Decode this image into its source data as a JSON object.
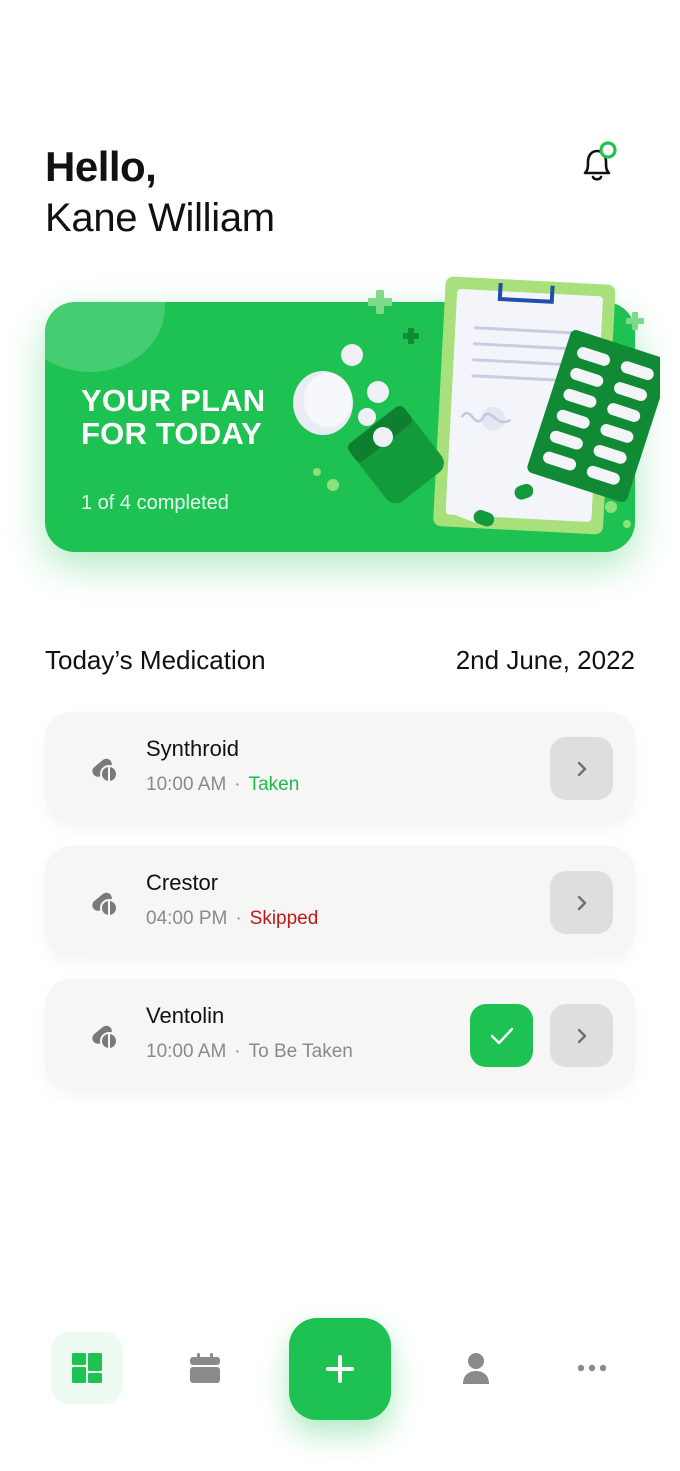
{
  "greeting": {
    "hello": "Hello,",
    "name": "Kane William"
  },
  "banner": {
    "title_line1": "YOUR PLAN",
    "title_line2": "FOR TODAY",
    "progress_text": "1 of 4 completed",
    "completed": 1,
    "total": 4
  },
  "medication": {
    "section_title": "Today’s Medication",
    "date": "2nd June, 2022",
    "items": [
      {
        "name": "Synthroid",
        "time": "10:00 AM",
        "status": "Taken"
      },
      {
        "name": "Crestor",
        "time": "04:00 PM",
        "status": "Skipped"
      },
      {
        "name": "Ventolin",
        "time": "10:00 AM",
        "status": "To Be Taken"
      }
    ]
  },
  "nav": {
    "items": [
      "dashboard-icon",
      "calendar-icon",
      "plus-icon",
      "profile-icon",
      "more-icon"
    ],
    "active": "dashboard-icon"
  },
  "colors": {
    "primary": "#1dc253",
    "taken": "#1dbb4d",
    "skipped": "#c01818",
    "muted": "#8a8a8a"
  }
}
